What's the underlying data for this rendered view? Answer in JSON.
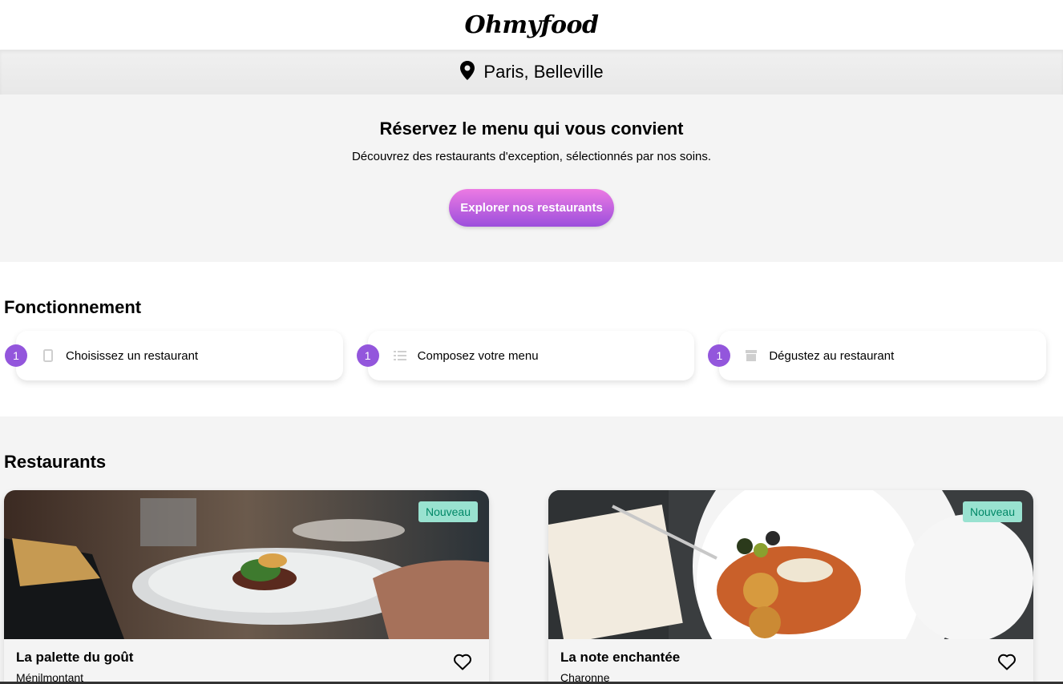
{
  "header": {
    "logo": "Ohmyfood"
  },
  "location": {
    "text": "Paris, Belleville",
    "icon": "map-pin-icon"
  },
  "hero": {
    "title": "Réservez le menu qui vous convient",
    "subtitle": "Découvrez des restaurants d'exception, sélectionnés par nos soins.",
    "button_label": "Explorer nos restaurants"
  },
  "howto": {
    "title": "Fonctionnement",
    "steps": [
      {
        "num": "1",
        "label": "Choisissez un restaurant",
        "icon": "mobile-icon"
      },
      {
        "num": "1",
        "label": "Composez votre menu",
        "icon": "list-icon"
      },
      {
        "num": "1",
        "label": "Dégustez au restaurant",
        "icon": "store-icon"
      }
    ]
  },
  "restaurants": {
    "title": "Restaurants",
    "items": [
      {
        "name": "La palette du goût",
        "area": "Ménilmontant",
        "badge": "Nouveau"
      },
      {
        "name": "La note enchantée",
        "area": "Charonne",
        "badge": "Nouveau"
      }
    ]
  },
  "colors": {
    "accent": "#9356dc",
    "button_top": "#ec7ae3",
    "badge_bg": "#99e2d0",
    "badge_text": "#008766"
  }
}
